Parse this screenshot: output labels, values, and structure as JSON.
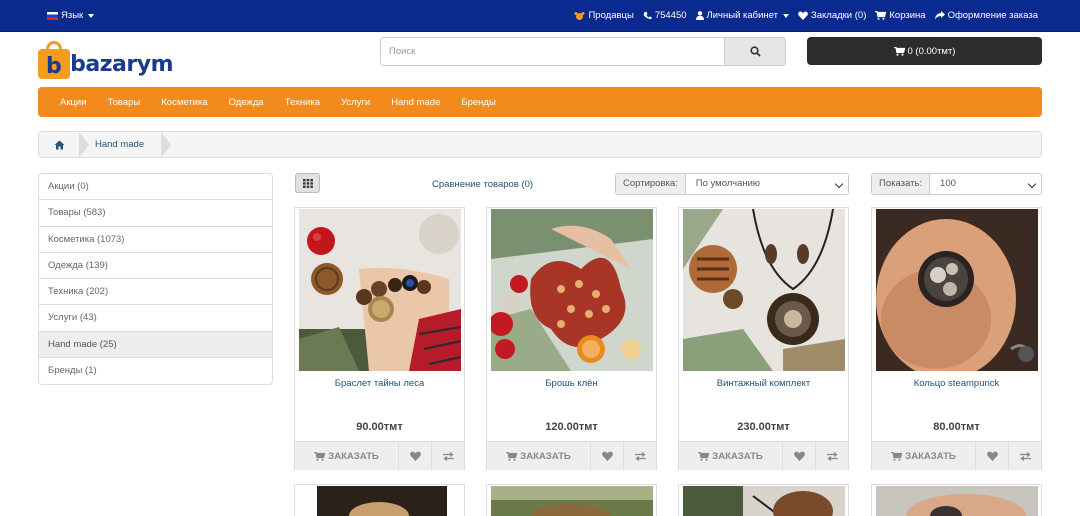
{
  "topbar": {
    "language": "Язык",
    "links": [
      {
        "icon": "sellers-icon",
        "label": "Продавцы"
      },
      {
        "icon": "phone-icon",
        "label": "754450"
      },
      {
        "icon": "user-icon",
        "label": "Личный кабинет"
      },
      {
        "icon": "heart-icon",
        "label": "Закладки (0)"
      },
      {
        "icon": "cart-icon",
        "label": "Корзина"
      },
      {
        "icon": "share-icon",
        "label": "Оформление заказа"
      }
    ]
  },
  "logo": {
    "text": "bazarym",
    "mark": "b"
  },
  "search": {
    "placeholder": "Поиск",
    "value": ""
  },
  "cart": {
    "label": "0 (0.00тмт)"
  },
  "nav": [
    "Акции",
    "Товары",
    "Косметика",
    "Одежда",
    "Техника",
    "Услуги",
    "Hand made",
    "Бренды"
  ],
  "breadcrumb": {
    "current": "Hand made"
  },
  "sidebar": {
    "items": [
      {
        "label": "Акции (0)",
        "active": false
      },
      {
        "label": "Товары (583)",
        "active": false
      },
      {
        "label": "Косметика (1073)",
        "active": false
      },
      {
        "label": "Одежда (139)",
        "active": false
      },
      {
        "label": "Техника (202)",
        "active": false
      },
      {
        "label": "Услуги (43)",
        "active": false
      },
      {
        "label": "Hand made (25)",
        "active": true
      },
      {
        "label": "Бренды (1)",
        "active": false
      }
    ]
  },
  "toolbar": {
    "compare": "Сравнение товаров (0)",
    "sort_label": "Сортировка:",
    "sort_value": "По умолчанию",
    "show_label": "Показать:",
    "show_value": "100"
  },
  "products": [
    {
      "name": "Браслет тайны леса",
      "price": "90.00тмт",
      "order": "ЗАКАЗАТЬ"
    },
    {
      "name": "Брошь клён",
      "price": "120.00тмт",
      "order": "ЗАКАЗАТЬ"
    },
    {
      "name": "Винтажный комплект",
      "price": "230.00тмт",
      "order": "ЗАКАЗАТЬ"
    },
    {
      "name": "Кольцо steampunck",
      "price": "80.00тмт",
      "order": "ЗАКАЗАТЬ"
    }
  ],
  "colors": {
    "topbar": "#0b2a8f",
    "nav": "#f28b1c",
    "link": "#23527c",
    "cart": "#2c2c2c"
  }
}
